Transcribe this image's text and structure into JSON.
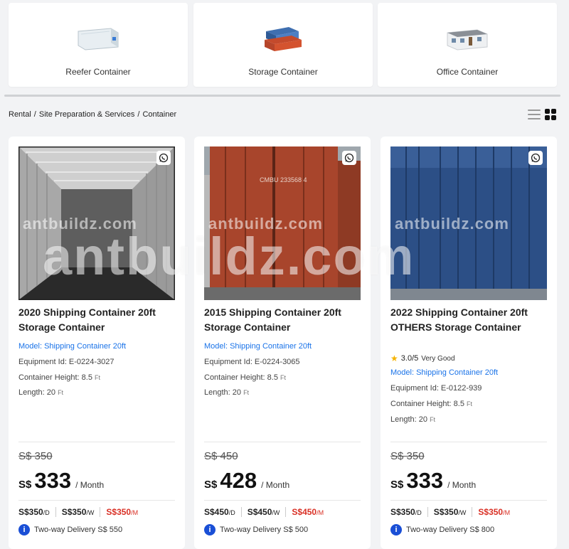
{
  "categories": [
    {
      "label": "Reefer Container",
      "icon": "reefer-container-icon"
    },
    {
      "label": "Storage Container",
      "icon": "storage-container-icon"
    },
    {
      "label": "Office Container",
      "icon": "office-container-icon"
    }
  ],
  "breadcrumb": [
    "Rental",
    "Site Preparation & Services",
    "Container"
  ],
  "watermark": "antbuildz.com",
  "colors": {
    "link": "#1a73e8",
    "monthly_rate": "#d93025",
    "info_icon": "#1a4fd6",
    "star": "#f5b301"
  },
  "products": [
    {
      "title": "2020 Shipping Container 20ft Storage Container",
      "model_label": "Model:",
      "model": "Shipping Container 20ft",
      "equipment_id": "Equipment Id: E-0224-3027",
      "height_label": "Container Height: 8.5",
      "height_unit": "Ft",
      "length_label": "Length: 20",
      "length_unit": "Ft",
      "old_price": "S$ 350",
      "currency": "S$",
      "price": "333",
      "per": "/ Month",
      "daily": "S$350",
      "daily_unit": "/D",
      "weekly": "S$350",
      "weekly_unit": "/W",
      "monthly": "S$350",
      "monthly_unit": "/M",
      "delivery": "Two-way Delivery S$ 550"
    },
    {
      "title": "2015 Shipping Container 20ft Storage Container",
      "model_label": "Model:",
      "model": "Shipping Container 20ft",
      "equipment_id": "Equipment Id: E-0224-3065",
      "height_label": "Container Height: 8.5",
      "height_unit": "Ft",
      "length_label": "Length: 20",
      "length_unit": "Ft",
      "old_price": "S$ 450",
      "currency": "S$",
      "price": "428",
      "per": "/ Month",
      "daily": "S$450",
      "daily_unit": "/D",
      "weekly": "S$450",
      "weekly_unit": "/W",
      "monthly": "S$450",
      "monthly_unit": "/M",
      "delivery": "Two-way Delivery S$ 500"
    },
    {
      "title": "2022 Shipping Container 20ft OTHERS Storage Container",
      "rating": "3.0",
      "rating_max": "/5",
      "rating_text": "Very Good",
      "model_label": "Model:",
      "model": "Shipping Container 20ft",
      "equipment_id": "Equipment Id: E-0122-939",
      "height_label": "Container Height: 8.5",
      "height_unit": "Ft",
      "length_label": "Length: 20",
      "length_unit": "Ft",
      "old_price": "S$ 350",
      "currency": "S$",
      "price": "333",
      "per": "/ Month",
      "daily": "S$350",
      "daily_unit": "/D",
      "weekly": "S$350",
      "weekly_unit": "/W",
      "monthly": "S$350",
      "monthly_unit": "/M",
      "delivery": "Two-way Delivery S$ 800"
    }
  ]
}
